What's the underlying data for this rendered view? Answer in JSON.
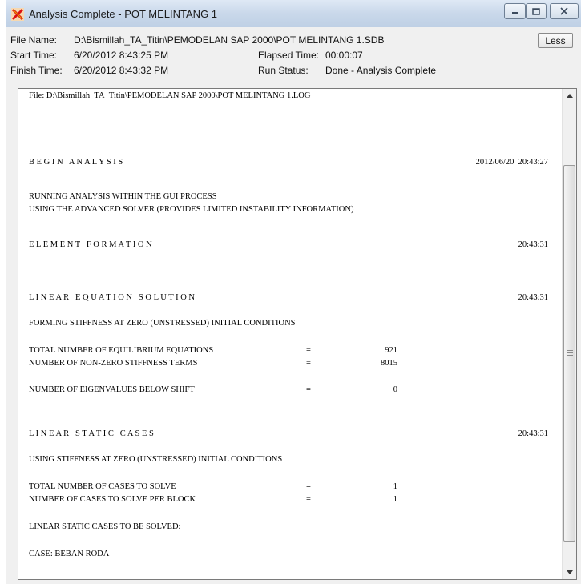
{
  "window": {
    "title": "Analysis Complete - POT MELINTANG 1",
    "icon": "app-x-icon",
    "controls": [
      "minimize-icon",
      "maximize-icon",
      "close-icon"
    ]
  },
  "info": {
    "file_name_label": "File Name:",
    "file_name_value": "D:\\Bismillah_TA_Titin\\PEMODELAN SAP 2000\\POT MELINTANG 1.SDB",
    "start_time_label": "Start Time:",
    "start_time_value": "6/20/2012 8:43:25 PM",
    "finish_time_label": "Finish Time:",
    "finish_time_value": "6/20/2012 8:43:32 PM",
    "elapsed_label": "Elapsed Time:",
    "elapsed_value": "00:00:07",
    "status_label": "Run Status:",
    "status_value": "Done - Analysis Complete"
  },
  "less_button": "Less",
  "log": {
    "file_line": "File: D:\\Bismillah_TA_Titin\\PEMODELAN SAP 2000\\POT MELINTANG 1.LOG",
    "begin_heading": "B E G I N   A N A L Y S I S",
    "begin_time": "2012/06/20  20:43:27",
    "gui_line": "RUNNING ANALYSIS WITHIN THE GUI PROCESS",
    "solver_line": "USING THE ADVANCED SOLVER (PROVIDES LIMITED INSTABILITY INFORMATION)",
    "element_heading": "E L E M E N T   F O R M A T I O N",
    "element_time": "20:43:31",
    "linear_eq_heading": "L I N E A R   E Q U A T I O N   S O L U T I O N",
    "linear_eq_time": "20:43:31",
    "forming_line": "FORMING STIFFNESS AT ZERO (UNSTRESSED) INITIAL CONDITIONS",
    "eq_rows": [
      {
        "label": "TOTAL NUMBER OF EQUILIBRIUM EQUATIONS",
        "eq": "=",
        "value": "921"
      },
      {
        "label": "NUMBER OF NON-ZERO STIFFNESS TERMS",
        "eq": "=",
        "value": "8015"
      },
      {
        "label": "NUMBER OF EIGENVALUES BELOW SHIFT",
        "eq": "=",
        "value": "0"
      }
    ],
    "static_heading": "L I N E A R   S T A T I C   C A S E S",
    "static_time": "20:43:31",
    "using_line": "USING STIFFNESS AT ZERO (UNSTRESSED) INITIAL CONDITIONS",
    "case_rows": [
      {
        "label": "TOTAL NUMBER OF CASES TO SOLVE",
        "eq": "=",
        "value": "1"
      },
      {
        "label": "NUMBER OF CASES TO SOLVE PER BLOCK",
        "eq": "=",
        "value": "1"
      }
    ],
    "to_be_solved_line": "LINEAR STATIC CASES TO BE SOLVED:",
    "case_line": "CASE: BEBAN RODA"
  }
}
